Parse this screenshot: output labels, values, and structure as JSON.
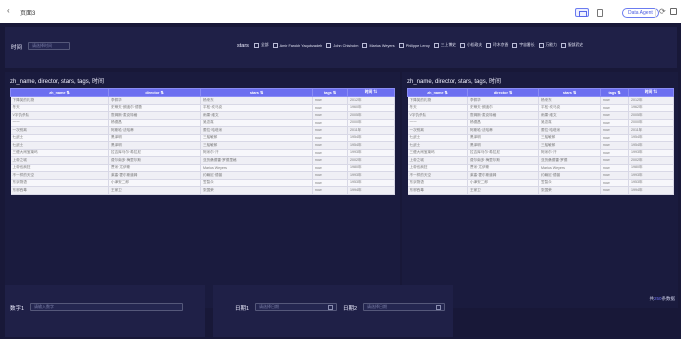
{
  "header": {
    "back_icon": "‹",
    "title": "页面3",
    "agent_label": "Data Agent"
  },
  "filter": {
    "time_label": "时间",
    "time_placeholder": "请选择时间",
    "stars_label": "stars",
    "stars_options": [
      "全部",
      "Amir Farokh Yaqubzadeh",
      "John Chisholm",
      "Marius Weyers",
      "Philippe Leroy",
      "三上博史",
      "小松政夫",
      "玲木京香",
      "宇宙番长",
      "万能力",
      "服部武史"
    ]
  },
  "tables": {
    "left": {
      "title": "zh_name, director, stars, tags, 时间",
      "columns": [
        "zh_name ⇅",
        "director ⇅",
        "stars ⇅",
        "tags ⇅",
        "时间 ⇅"
      ],
      "rows": [
        [
          "下降英的礼物",
          "李佩华",
          "杨来东",
          "now",
          "2012年"
        ],
        [
          "冬天",
          "史蒂夫·朗迪尔·德鲁",
          "平松·坎马克",
          "now",
          "1960年"
        ],
        [
          "V字仇杀队",
          "詹姆斯·麦克特格",
          "雨果·维文",
          "now",
          "2005年"
        ],
        [
          "一一",
          "杨德昌",
          "吴念真",
          "now",
          "2000年"
        ],
        [
          "一次别离",
          "阿斯哈·法哈蒂",
          "蕾拉·哈塔米",
          "now",
          "2011年"
        ],
        [
          "七武士",
          "黑泽明",
          "三船敏郎",
          "now",
          "1954年"
        ],
        [
          "七武士",
          "黑泽明",
          "三船敏郎",
          "now",
          "1954年"
        ],
        [
          "三傻大闹宝莱坞",
          "拉吉库马尔·希拉尼",
          "阿米尔·汗",
          "now",
          "1993年"
        ],
        [
          "上帝之城",
          "费尔南多·梅里尔斯",
          "亚历桑德雷·罗德里格",
          "now",
          "2002年"
        ],
        [
          "上帝也疯狂",
          "贾米·尤伊斯",
          "Marius Weyers",
          "now",
          "1980年"
        ],
        [
          "不一样的天空",
          "莱塞·霍尔斯道姆",
          "约翰尼·德普",
          "now",
          "1993年"
        ],
        [
          "东京物语",
          "小津安二郎",
          "笠智众",
          "now",
          "1953年"
        ],
        [
          "东邪西毒",
          "王家卫",
          "张国荣",
          "now",
          "1994年"
        ]
      ],
      "total_prefix": "共",
      "total_num": "250",
      "total_suffix": "条数据"
    },
    "right": {
      "title": "zh_name, director, stars, tags, 时间",
      "columns": [
        "zh_name ⇅",
        "director ⇅",
        "stars ⇅",
        "tags ⇅",
        "时间 ⇅"
      ],
      "rows": [
        [
          "下降英的礼物",
          "李佩华",
          "杨来东",
          "now",
          "2012年"
        ],
        [
          "冬天",
          "史蒂夫·朗迪尔",
          "平松·坎马克",
          "now",
          "1962年"
        ],
        [
          "V字仇杀队",
          "詹姆斯·麦克特格",
          "雨果·维文",
          "now",
          "2005年"
        ],
        [
          "一一",
          "杨德昌",
          "吴念真",
          "now",
          "2000年"
        ],
        [
          "一次别离",
          "阿斯哈·法哈蒂",
          "蕾拉·哈塔米",
          "now",
          "2011年"
        ],
        [
          "七武士",
          "黑泽明",
          "三船敏郎",
          "now",
          "1954年"
        ],
        [
          "七武士",
          "黑泽明",
          "三船敏郎",
          "now",
          "1954年"
        ],
        [
          "三傻大闹宝莱坞",
          "拉吉库马尔·希拉尼",
          "阿米尔·汗",
          "now",
          "1993年"
        ],
        [
          "上帝之城",
          "费尔南多·梅里尔斯",
          "亚历桑德雷·罗德",
          "now",
          "2002年"
        ],
        [
          "上帝也疯狂",
          "贾米·尤伊斯",
          "Marius Weyers",
          "now",
          "1980年"
        ],
        [
          "不一样的天空",
          "莱塞·霍尔斯道姆",
          "约翰尼·德普",
          "now",
          "1993年"
        ],
        [
          "东京物语",
          "小津安二郎",
          "笠智众",
          "now",
          "1953年"
        ],
        [
          "东邪西毒",
          "王家卫",
          "张国荣",
          "now",
          "1994年"
        ]
      ],
      "total_prefix": "共",
      "total_num": "250",
      "total_suffix": "条数据"
    }
  },
  "bottom": {
    "number_label": "数字1",
    "number_placeholder": "请输入数字",
    "date1_label": "日期1",
    "date1_placeholder": "请选择日期",
    "date2_label": "日期2",
    "date2_placeholder": "请选择日期"
  },
  "colors": {
    "accent": "#6c6ff0",
    "background": "#181838",
    "card": "#1f2047"
  }
}
